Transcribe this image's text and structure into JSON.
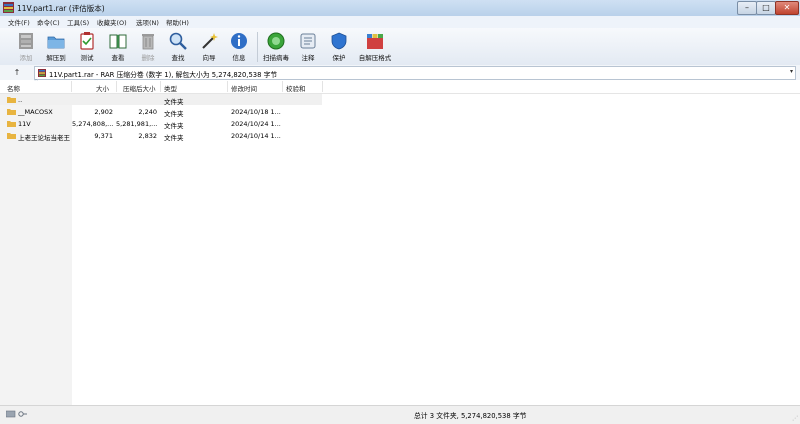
{
  "window": {
    "title": "11V.part1.rar (评估版本)"
  },
  "menu": [
    "文件(F)",
    "命令(C)",
    "工具(S)",
    "收藏夹(O)",
    "选项(N)",
    "帮助(H)"
  ],
  "toolbar": [
    {
      "label": "添加",
      "icon": "add-archive-icon",
      "enabled": false
    },
    {
      "label": "解压到",
      "icon": "extract-folder-icon",
      "enabled": true
    },
    {
      "label": "测试",
      "icon": "test-clipboard-icon",
      "enabled": true
    },
    {
      "label": "查看",
      "icon": "view-book-icon",
      "enabled": true
    },
    {
      "label": "删除",
      "icon": "trash-icon",
      "enabled": false
    },
    {
      "label": "查找",
      "icon": "magnifier-icon",
      "enabled": true
    },
    {
      "label": "向导",
      "icon": "wizard-wand-icon",
      "enabled": true
    },
    {
      "label": "信息",
      "icon": "info-icon",
      "enabled": true
    },
    {
      "label": "扫描病毒",
      "icon": "virus-scan-icon",
      "enabled": true
    },
    {
      "label": "注释",
      "icon": "comment-icon",
      "enabled": true
    },
    {
      "label": "保护",
      "icon": "shield-icon",
      "enabled": true
    },
    {
      "label": "自解压格式",
      "icon": "sfx-box-icon",
      "enabled": true
    }
  ],
  "address": {
    "up_label": "↑",
    "path": "11V.part1.rar - RAR 压缩分卷 (数字 1), 解包大小为 5,274,820,538 字节"
  },
  "columns": [
    "名称",
    "大小",
    "压缩后大小",
    "类型",
    "修改时间",
    "校验和"
  ],
  "rows": [
    {
      "name": "..",
      "size": "",
      "packed": "",
      "type": "文件夹",
      "modified": "",
      "crc": ""
    },
    {
      "name": "__MACOSX",
      "size": "2,902",
      "packed": "2,240",
      "type": "文件夹",
      "modified": "2024/10/18 1...",
      "crc": ""
    },
    {
      "name": "11V",
      "size": "5,274,808,...",
      "packed": "5,281,981,...",
      "type": "文件夹",
      "modified": "2024/10/24 1...",
      "crc": ""
    },
    {
      "name": "上老王论坛当老王",
      "size": "9,371",
      "packed": "2,832",
      "type": "文件夹",
      "modified": "2024/10/14 1...",
      "crc": ""
    }
  ],
  "status": {
    "text": "总计 3 文件夹, 5,274,820,538 字节"
  },
  "colors": {
    "folder": "#e8b440",
    "titlebar": "#c4d8ee",
    "close": "#c9503d"
  }
}
